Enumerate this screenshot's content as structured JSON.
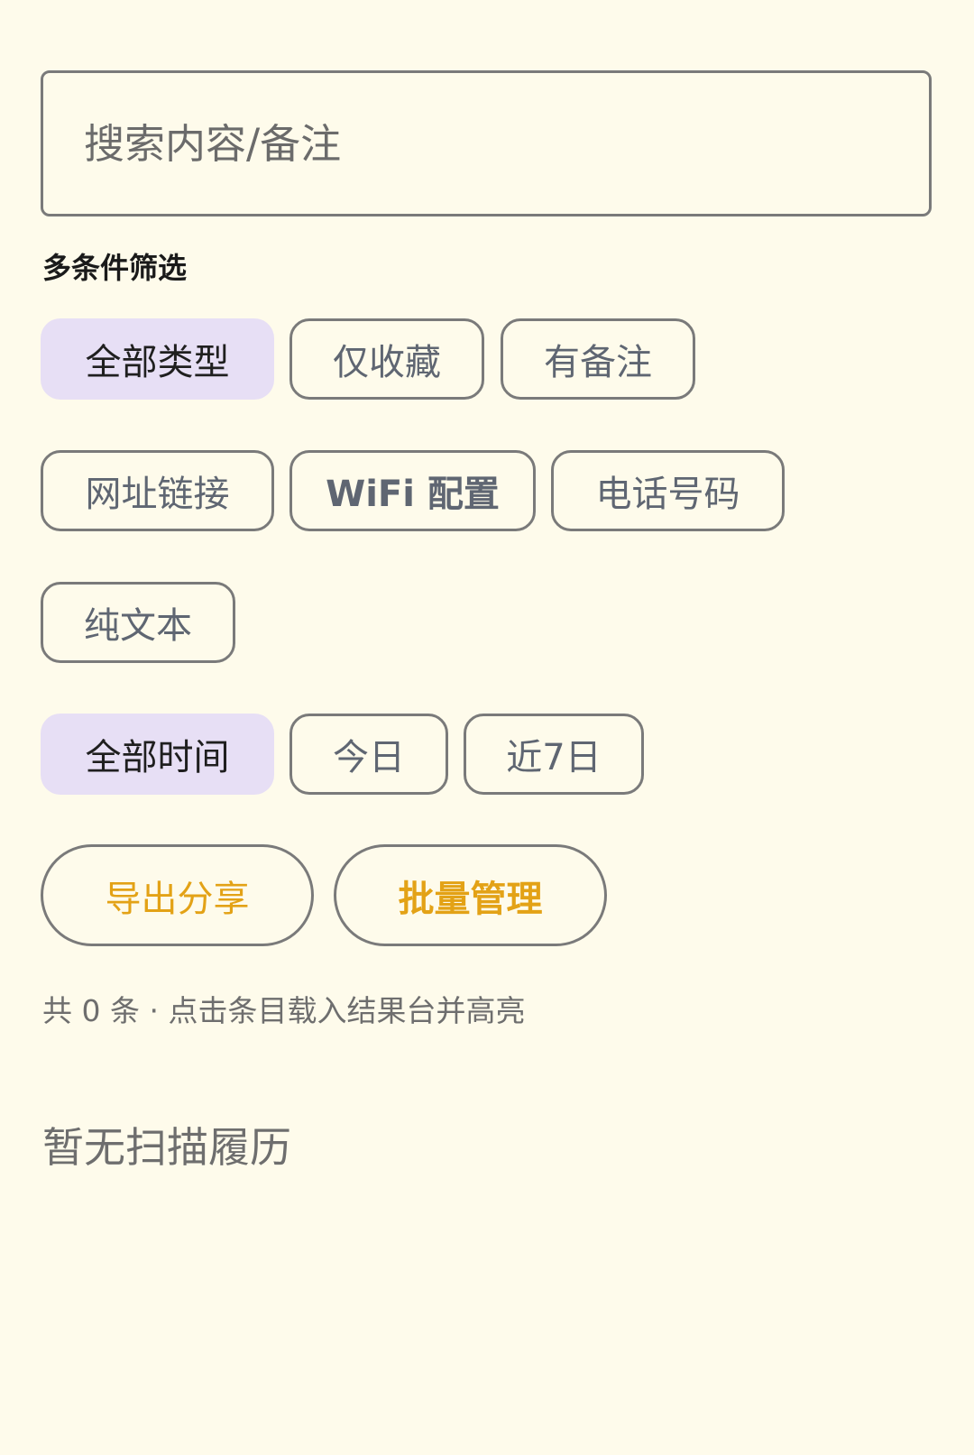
{
  "search": {
    "placeholder": "搜索内容/备注",
    "value": ""
  },
  "filter": {
    "title": "多条件筛选",
    "row1": [
      "全部类型",
      "仅收藏",
      "有备注"
    ],
    "row2": [
      "网址链接",
      "WiFi 配置",
      "电话号码"
    ],
    "row3": [
      "纯文本"
    ],
    "time": [
      "全部时间",
      "今日",
      "近7日"
    ]
  },
  "actions": {
    "export": "导出分享",
    "batch": "批量管理"
  },
  "status": {
    "count_text": "共 0 条 · 点击条目载入结果台并高亮",
    "empty_text": "暂无扫描履历"
  },
  "colors": {
    "background": "#fefbeb",
    "selected_chip": "#e7dff5",
    "accent": "#e3a216",
    "border": "#7a7a7a"
  }
}
